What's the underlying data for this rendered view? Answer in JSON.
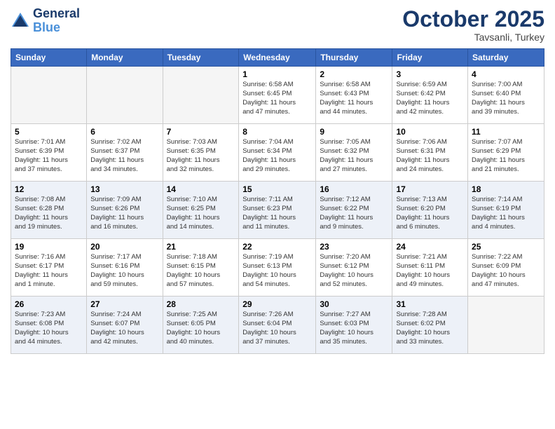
{
  "header": {
    "logo_line1": "General",
    "logo_line2": "Blue",
    "month": "October 2025",
    "location": "Tavsanli, Turkey"
  },
  "days_of_week": [
    "Sunday",
    "Monday",
    "Tuesday",
    "Wednesday",
    "Thursday",
    "Friday",
    "Saturday"
  ],
  "weeks": [
    [
      {
        "day": "",
        "info": ""
      },
      {
        "day": "",
        "info": ""
      },
      {
        "day": "",
        "info": ""
      },
      {
        "day": "1",
        "info": "Sunrise: 6:58 AM\nSunset: 6:45 PM\nDaylight: 11 hours\nand 47 minutes."
      },
      {
        "day": "2",
        "info": "Sunrise: 6:58 AM\nSunset: 6:43 PM\nDaylight: 11 hours\nand 44 minutes."
      },
      {
        "day": "3",
        "info": "Sunrise: 6:59 AM\nSunset: 6:42 PM\nDaylight: 11 hours\nand 42 minutes."
      },
      {
        "day": "4",
        "info": "Sunrise: 7:00 AM\nSunset: 6:40 PM\nDaylight: 11 hours\nand 39 minutes."
      }
    ],
    [
      {
        "day": "5",
        "info": "Sunrise: 7:01 AM\nSunset: 6:39 PM\nDaylight: 11 hours\nand 37 minutes."
      },
      {
        "day": "6",
        "info": "Sunrise: 7:02 AM\nSunset: 6:37 PM\nDaylight: 11 hours\nand 34 minutes."
      },
      {
        "day": "7",
        "info": "Sunrise: 7:03 AM\nSunset: 6:35 PM\nDaylight: 11 hours\nand 32 minutes."
      },
      {
        "day": "8",
        "info": "Sunrise: 7:04 AM\nSunset: 6:34 PM\nDaylight: 11 hours\nand 29 minutes."
      },
      {
        "day": "9",
        "info": "Sunrise: 7:05 AM\nSunset: 6:32 PM\nDaylight: 11 hours\nand 27 minutes."
      },
      {
        "day": "10",
        "info": "Sunrise: 7:06 AM\nSunset: 6:31 PM\nDaylight: 11 hours\nand 24 minutes."
      },
      {
        "day": "11",
        "info": "Sunrise: 7:07 AM\nSunset: 6:29 PM\nDaylight: 11 hours\nand 21 minutes."
      }
    ],
    [
      {
        "day": "12",
        "info": "Sunrise: 7:08 AM\nSunset: 6:28 PM\nDaylight: 11 hours\nand 19 minutes."
      },
      {
        "day": "13",
        "info": "Sunrise: 7:09 AM\nSunset: 6:26 PM\nDaylight: 11 hours\nand 16 minutes."
      },
      {
        "day": "14",
        "info": "Sunrise: 7:10 AM\nSunset: 6:25 PM\nDaylight: 11 hours\nand 14 minutes."
      },
      {
        "day": "15",
        "info": "Sunrise: 7:11 AM\nSunset: 6:23 PM\nDaylight: 11 hours\nand 11 minutes."
      },
      {
        "day": "16",
        "info": "Sunrise: 7:12 AM\nSunset: 6:22 PM\nDaylight: 11 hours\nand 9 minutes."
      },
      {
        "day": "17",
        "info": "Sunrise: 7:13 AM\nSunset: 6:20 PM\nDaylight: 11 hours\nand 6 minutes."
      },
      {
        "day": "18",
        "info": "Sunrise: 7:14 AM\nSunset: 6:19 PM\nDaylight: 11 hours\nand 4 minutes."
      }
    ],
    [
      {
        "day": "19",
        "info": "Sunrise: 7:16 AM\nSunset: 6:17 PM\nDaylight: 11 hours\nand 1 minute."
      },
      {
        "day": "20",
        "info": "Sunrise: 7:17 AM\nSunset: 6:16 PM\nDaylight: 10 hours\nand 59 minutes."
      },
      {
        "day": "21",
        "info": "Sunrise: 7:18 AM\nSunset: 6:15 PM\nDaylight: 10 hours\nand 57 minutes."
      },
      {
        "day": "22",
        "info": "Sunrise: 7:19 AM\nSunset: 6:13 PM\nDaylight: 10 hours\nand 54 minutes."
      },
      {
        "day": "23",
        "info": "Sunrise: 7:20 AM\nSunset: 6:12 PM\nDaylight: 10 hours\nand 52 minutes."
      },
      {
        "day": "24",
        "info": "Sunrise: 7:21 AM\nSunset: 6:11 PM\nDaylight: 10 hours\nand 49 minutes."
      },
      {
        "day": "25",
        "info": "Sunrise: 7:22 AM\nSunset: 6:09 PM\nDaylight: 10 hours\nand 47 minutes."
      }
    ],
    [
      {
        "day": "26",
        "info": "Sunrise: 7:23 AM\nSunset: 6:08 PM\nDaylight: 10 hours\nand 44 minutes."
      },
      {
        "day": "27",
        "info": "Sunrise: 7:24 AM\nSunset: 6:07 PM\nDaylight: 10 hours\nand 42 minutes."
      },
      {
        "day": "28",
        "info": "Sunrise: 7:25 AM\nSunset: 6:05 PM\nDaylight: 10 hours\nand 40 minutes."
      },
      {
        "day": "29",
        "info": "Sunrise: 7:26 AM\nSunset: 6:04 PM\nDaylight: 10 hours\nand 37 minutes."
      },
      {
        "day": "30",
        "info": "Sunrise: 7:27 AM\nSunset: 6:03 PM\nDaylight: 10 hours\nand 35 minutes."
      },
      {
        "day": "31",
        "info": "Sunrise: 7:28 AM\nSunset: 6:02 PM\nDaylight: 10 hours\nand 33 minutes."
      },
      {
        "day": "",
        "info": ""
      }
    ]
  ]
}
